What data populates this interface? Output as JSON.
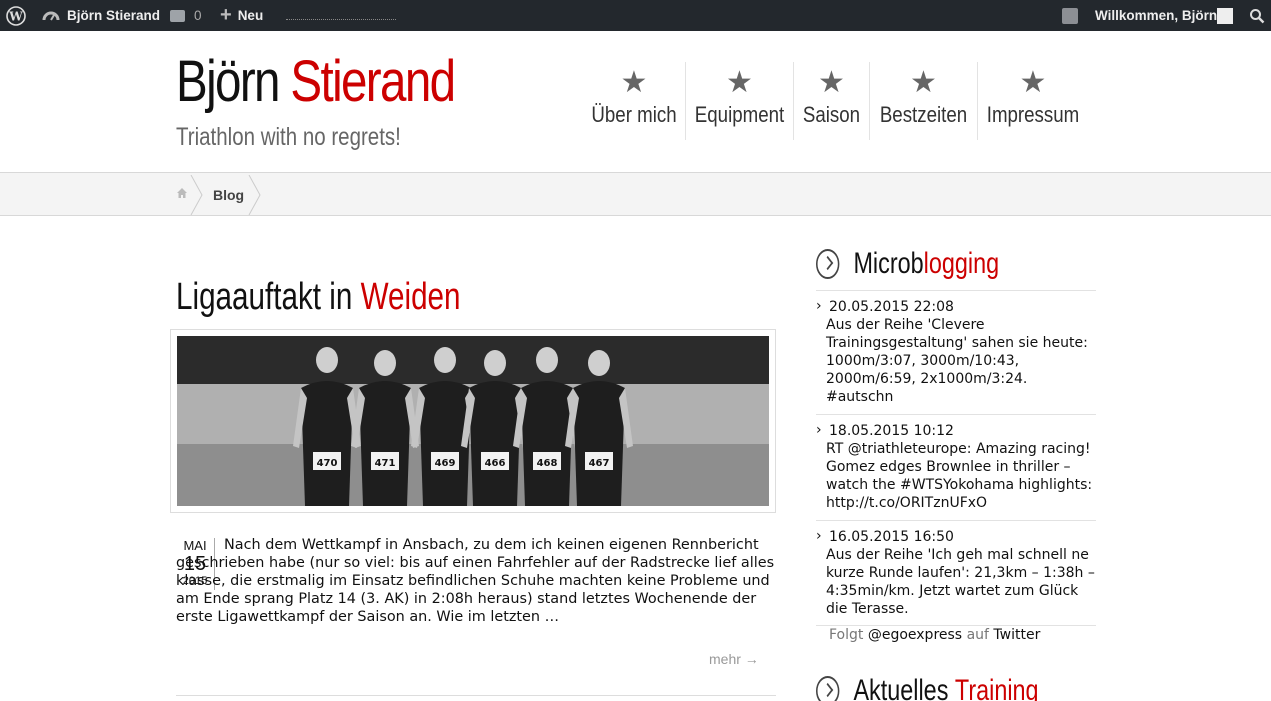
{
  "adminbar": {
    "site_name": "Björn Stierand",
    "comment_count": "0",
    "new_label": "Neu",
    "welcome": "Willkommen, Björn"
  },
  "header": {
    "title_first": "Björn",
    "title_second": "Stierand",
    "tagline": "Triathlon with no regrets!"
  },
  "nav": {
    "items": [
      {
        "label": "Über mich"
      },
      {
        "label": "Equipment"
      },
      {
        "label": "Saison"
      },
      {
        "label": "Bestzeiten"
      },
      {
        "label": "Impressum"
      }
    ]
  },
  "breadcrumb": {
    "current": "Blog"
  },
  "post": {
    "title_first": "Ligaauftakt in",
    "title_second": "Weiden",
    "date_month": "MAI",
    "date_day": "15",
    "date_year": "2015",
    "excerpt": "Nach dem Wettkampf in Ansbach, zu dem ich keinen eigenen Rennbericht geschrieben habe (nur so viel: bis auf einen Fahrfehler auf der Radstrecke lief alles klasse, die erstmalig im Einsatz befindlichen Schuhe machten keine Probleme und am Ende sprang Platz 14 (3. AK) in 2:08h heraus) stand letztes Wochenende der erste Ligawettkampf der Saison an. Wie im letzten …",
    "more_label": "mehr →",
    "bib_numbers": [
      "470",
      "471",
      "469",
      "466",
      "468",
      "467"
    ]
  },
  "sidebar": {
    "microblog": {
      "title_dark": "Microb",
      "title_red": "logging",
      "tweets": [
        {
          "time": "20.05.2015 22:08",
          "text": "Aus der Reihe 'Clevere Trainingsgestaltung' sahen sie heute: 1000m/3:07, 3000m/10:43, 2000m/6:59, 2x1000m/3:24. #autschn"
        },
        {
          "time": "18.05.2015 10:12",
          "text": "RT @triathleteurope: Amazing racing! Gomez edges Brownlee in thriller – watch the #WTSYokohama highlights: http://t.co/ORITznUFxO"
        },
        {
          "time": "16.05.2015 16:50",
          "text": "Aus der Reihe 'Ich geh mal schnell ne kurze Runde laufen': 21,3km – 1:38h – 4:35min/km. Jetzt wartet zum Glück die Terasse."
        }
      ],
      "follow_prefix": "Folgt",
      "follow_handle": "@egoexpress",
      "follow_on": "auf",
      "follow_service": "Twitter"
    },
    "training": {
      "title_dark": "Aktuelles",
      "title_red": "Training"
    }
  },
  "colors": {
    "accent": "#cc0000",
    "adminbar_bg": "#23282d",
    "crumb_bg": "#f4f4f4"
  }
}
